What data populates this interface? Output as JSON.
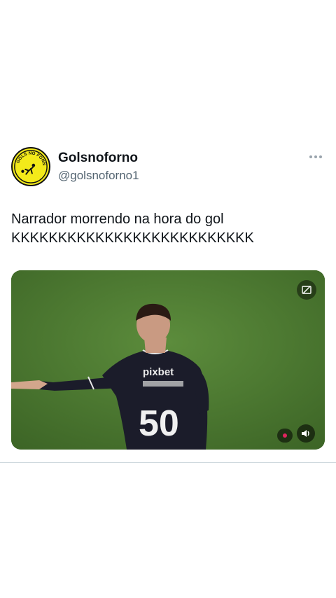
{
  "account": {
    "display_name": "Golsnoforno",
    "handle": "@golsnoforno1",
    "avatar_text": "GOLS NO FORNO"
  },
  "tweet": {
    "line1": "Narrador morrendo na hora do gol",
    "line2": "KKKKKKKKKKKKKKKKKKKKKKKKKK"
  },
  "media": {
    "type": "video",
    "player_number": "50",
    "sponsor": "pixbet",
    "overlay_icons": [
      "fullscreen-icon",
      "volume-icon"
    ]
  },
  "colors": {
    "avatar_bg": "#f3ea1a",
    "pitch": "#4c7a30",
    "jersey": "#1b1c2a",
    "handle": "#536471"
  }
}
